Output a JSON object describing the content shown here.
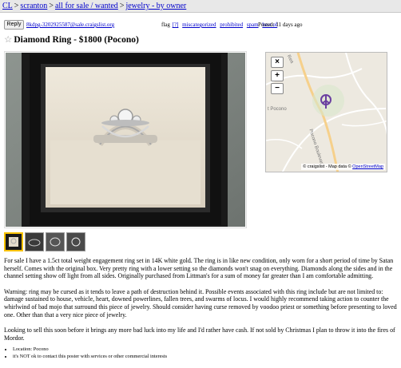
{
  "breadcrumb": {
    "items": [
      "CL",
      "scranton",
      "all for sale / wanted",
      "jewelry - by owner"
    ],
    "separator": ">"
  },
  "posting_bar": {
    "reply_label": "Reply",
    "reply_email": "8kdpg-3202925587@sale.craigslist.org",
    "flag_label": "flag",
    "flag_question": "[?]",
    "flag_options": [
      "miscategorized",
      "prohibited",
      "spam",
      "best of"
    ],
    "posted": "Posted: 11 days ago"
  },
  "title": {
    "star": "☆",
    "text": "Diamond Ring - $1800 (Pocono)"
  },
  "map": {
    "zoom_in": "+",
    "zoom_out": "−",
    "close": "×",
    "place_label": "t Pocono",
    "road_label": "Pocono Boulevard",
    "road_label_2": "Rea",
    "attribution_prefix": "© craigslist - Map data © ",
    "attribution_link": "OpenStreetMap"
  },
  "thumbnails": {
    "count": 4,
    "selected": 0
  },
  "body": {
    "paragraphs": [
      "For sale I have a 1.5ct total weight engagement ring set in 14K white gold. The ring is in like new condition, only worn for a short period of time by Satan herself. Comes with the original box. Very pretty ring with a lower setting so the diamonds won't snag on everything. Diamonds along the sides and in the channel setting show off light from all sides. Originally purchased from Littman's for a sum of money far greater than I am comfortable admitting.",
      "Warning: ring may be cursed as it tends to leave a path of destruction behind it. Possible events associated with this ring include but are not limited to: damage sustained to house, vehicle, heart, downed powerlines, fallen trees, and swarms of locus. I would highly recommend taking action to counter the whirlwind of bad mojo that surround this piece of jewelry. Should consider having curse removed by voodoo priest or something before presenting to loved one. Other than that a very nice piece of jewelry.",
      "Looking to sell this soon before it brings any more bad luck into my life and I'd rather have cash. If not sold by Christmas I plan to throw it into the fires of Mordor."
    ],
    "notices": [
      "Location: Pocono",
      "it's NOT ok to contact this poster with services or other commercial interests"
    ]
  },
  "colors": {
    "link": "#0000cc",
    "crumb_bar": "#e8e8e8",
    "map_pin": "#6a3fa0",
    "thumb_selected": "#f8c200"
  }
}
